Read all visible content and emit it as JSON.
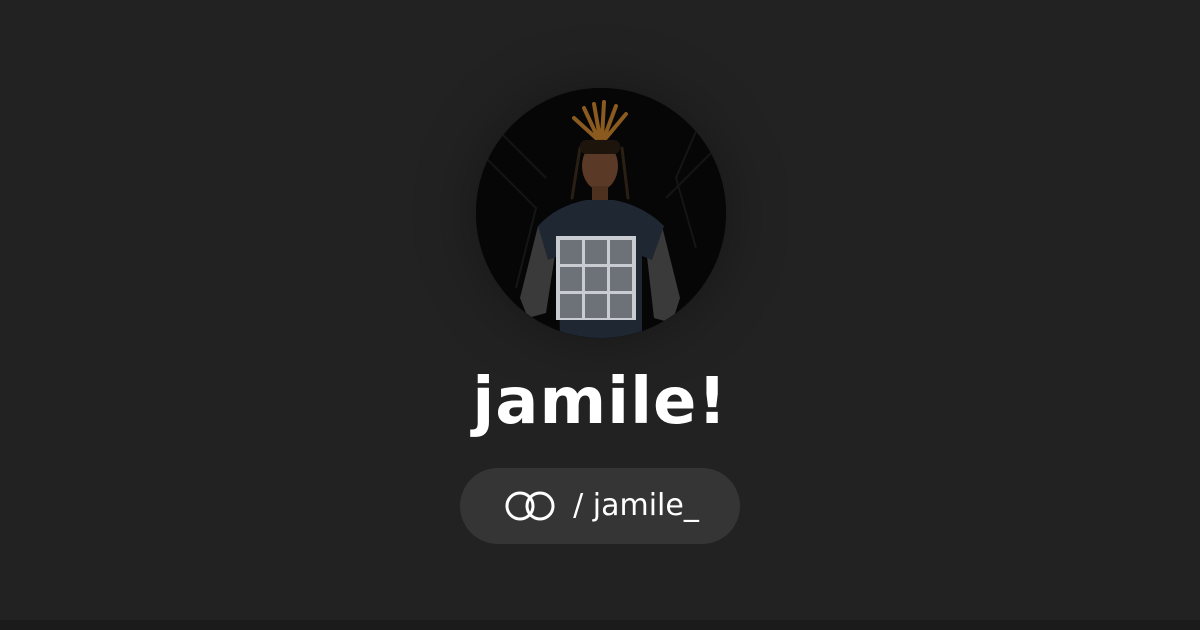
{
  "profile": {
    "display_name": "jamile!",
    "handle": "/ jamile_"
  },
  "icons": {
    "avatar": "profile-photo",
    "handle_icon": "linked-circles-icon"
  },
  "colors": {
    "background": "#222222",
    "pill_background": "#353535",
    "text": "#ffffff"
  }
}
